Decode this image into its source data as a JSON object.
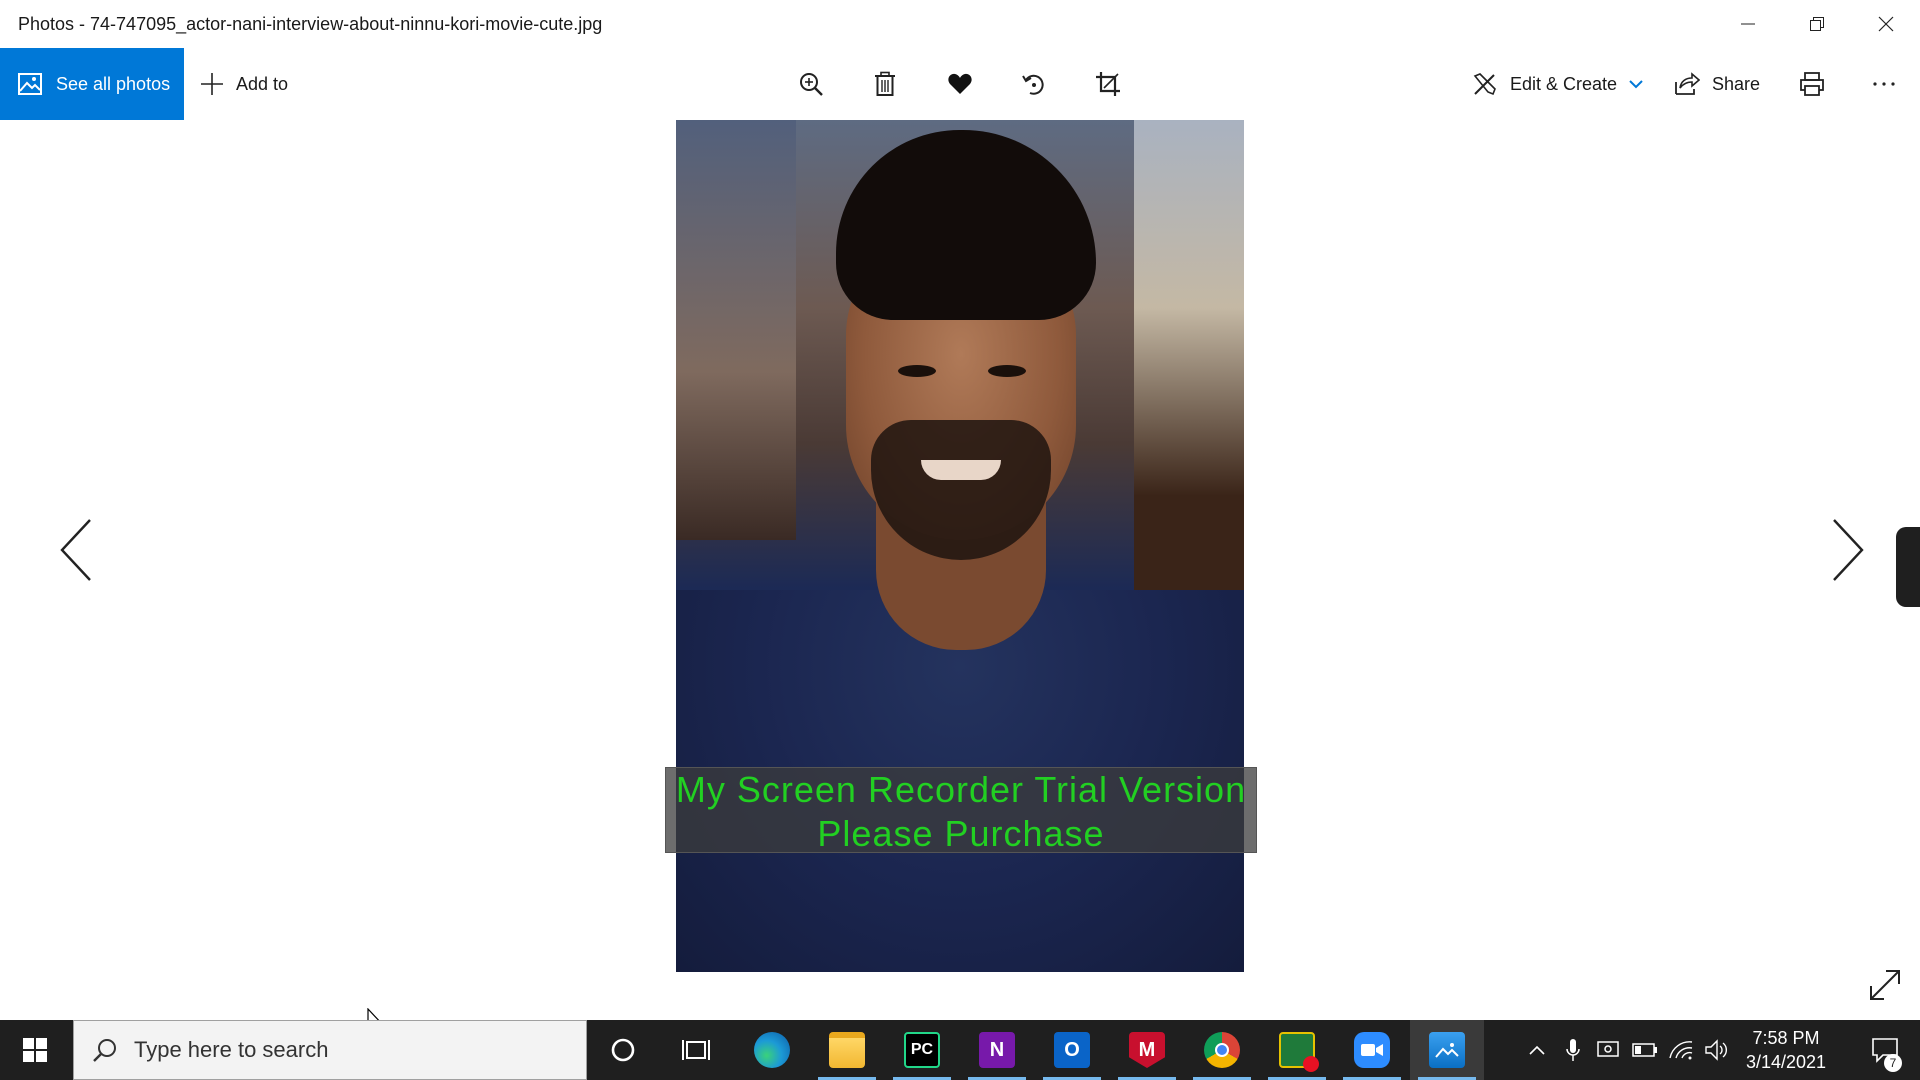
{
  "window": {
    "title": "Photos - 74-747095_actor-nani-interview-about-ninnu-kori-movie-cute.jpg"
  },
  "toolbar": {
    "see_all_label": "See all photos",
    "add_to_label": "Add to",
    "edit_create_label": "Edit & Create",
    "share_label": "Share",
    "accent_color": "#0078d7"
  },
  "viewer": {
    "watermark_line1": "My Screen Recorder Trial Version",
    "watermark_line2": "Please Purchase"
  },
  "taskbar": {
    "search_placeholder": "Type here to search",
    "time": "7:58 PM",
    "date": "3/14/2021",
    "notification_count": "7",
    "apps": [
      "cortana",
      "task-view",
      "edge",
      "file-explorer",
      "pycharm",
      "onenote",
      "outlook",
      "mcafee",
      "chrome",
      "screen-recorder",
      "zoom",
      "photos"
    ],
    "active_app": "photos"
  }
}
